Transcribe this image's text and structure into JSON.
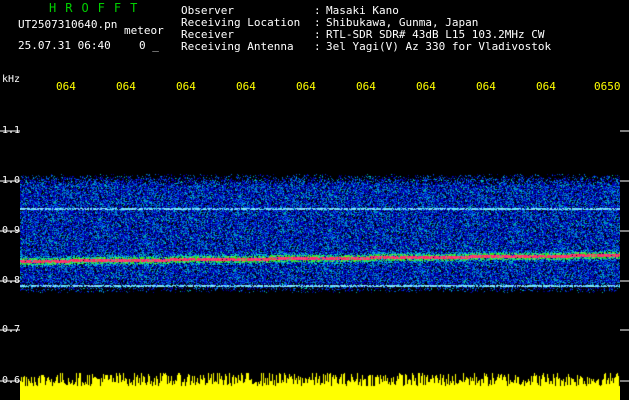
{
  "header": {
    "app_title": "HROFFT",
    "file_name": "UT2507310640.pn",
    "meteor_label": "meteor",
    "date_time": "25.07.31 06:40",
    "count": "0 _"
  },
  "info": [
    {
      "key": "Observer",
      "value": "Masaki Kano"
    },
    {
      "key": "Receiving Location",
      "value": "Shibukawa, Gunma, Japan"
    },
    {
      "key": "Receiver",
      "value": "RTL-SDR SDR# 43dB L15 103.2MHz CW"
    },
    {
      "key": "Receiving Antenna",
      "value": "3el Yagi(V) Az 330 for Vladivostok"
    }
  ],
  "axis": {
    "unit": "kHz",
    "time_ticks": [
      "064",
      "064",
      "064",
      "064",
      "064",
      "064",
      "064",
      "064",
      "064",
      "0650"
    ],
    "freq_ticks": [
      "1.1",
      "1.0",
      "0.9",
      "0.8",
      "0.7",
      "0.6"
    ]
  },
  "colors": {
    "background": "#000000",
    "title": "#00d000",
    "text": "#ffffff",
    "time_ticks": "#ffff00",
    "signal_strong": "#ff2050",
    "signal_mid": "#00e0a0",
    "noise": "#1030c0",
    "level_bar": "#ffff00",
    "grid": "#ffffff"
  }
}
